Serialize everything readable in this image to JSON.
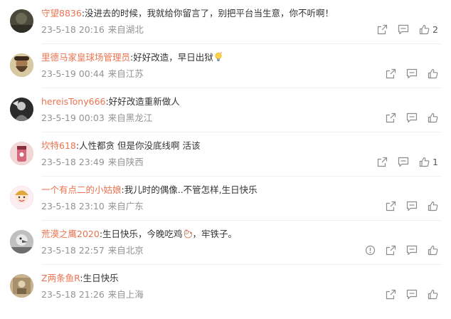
{
  "comments": [
    {
      "user": "守望8836",
      "text": ":没进去的时候，我就给你留言了，别把平台当生意，你不听啊！",
      "after_emoji": "",
      "emoji": "",
      "date": "23-5-18 20:16",
      "source": "来自湖北",
      "like_count": "2",
      "show_report": false,
      "avatar_icon": "dark-landscape-avatar"
    },
    {
      "user": "里德马家皇球场管理员",
      "text": ":好好改造，早日出狱",
      "after_emoji": "",
      "emoji": "lightbulb-emoji",
      "date": "23-5-19 00:44",
      "source": "来自江苏",
      "like_count": "",
      "show_report": false,
      "avatar_icon": "bearded-man-avatar"
    },
    {
      "user": "hereisTony666",
      "text": ":好好改造重新做人",
      "after_emoji": "",
      "emoji": "",
      "date": "23-5-19 00:03",
      "source": "来自黑龙江",
      "like_count": "",
      "show_report": false,
      "avatar_icon": "dark-figure-avatar"
    },
    {
      "user": "坎特618",
      "text": ":人性都贪 但是你没底线啊 活该",
      "after_emoji": "",
      "emoji": "",
      "date": "23-5-18 23:49",
      "source": "来自陕西",
      "like_count": "1",
      "show_report": false,
      "avatar_icon": "pink-cup-avatar"
    },
    {
      "user": "一个有点二的小姑娘",
      "text": ":我儿时的偶像..不管怎样,生日快乐",
      "after_emoji": "",
      "emoji": "",
      "date": "23-5-18 23:10",
      "source": "来自广东",
      "like_count": "",
      "show_report": false,
      "avatar_icon": "cartoon-girl-avatar"
    },
    {
      "user": "荒漠之鹰2020",
      "text": ":生日快乐，今晚吃鸡",
      "after_emoji": "，牢铁子。",
      "emoji": "chicken-emoji",
      "date": "23-5-18 22:57",
      "source": "来自北京",
      "like_count": "",
      "show_report": true,
      "avatar_icon": "eagle-avatar"
    },
    {
      "user": "Z两条鱼R",
      "text": ":生日快乐",
      "after_emoji": "",
      "emoji": "",
      "date": "23-5-18 21:26",
      "source": "来自上海",
      "like_count": "",
      "show_report": false,
      "avatar_icon": "sepia-photo-avatar"
    }
  ],
  "colors": {
    "username": "#eb7350",
    "text": "#333333",
    "meta": "#939393",
    "icon": "#8c8c8c"
  }
}
